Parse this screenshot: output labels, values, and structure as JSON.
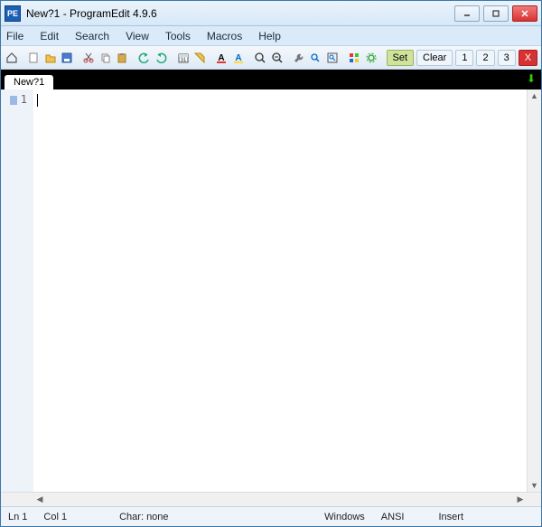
{
  "app_icon_text": "PE",
  "title": "New?1  -  ProgramEdit 4.9.6",
  "menu": [
    "File",
    "Edit",
    "Search",
    "View",
    "Tools",
    "Macros",
    "Help"
  ],
  "toolbar_labels": {
    "set": "Set",
    "clear": "Clear",
    "b1": "1",
    "b2": "2",
    "b3": "3",
    "x": "X"
  },
  "tab": {
    "label": "New?1"
  },
  "gutter": {
    "line1": "1"
  },
  "status": {
    "ln": "Ln 1",
    "col": "Col 1",
    "char": "Char: none",
    "eol": "Windows",
    "enc": "ANSI",
    "mode": "Insert"
  }
}
